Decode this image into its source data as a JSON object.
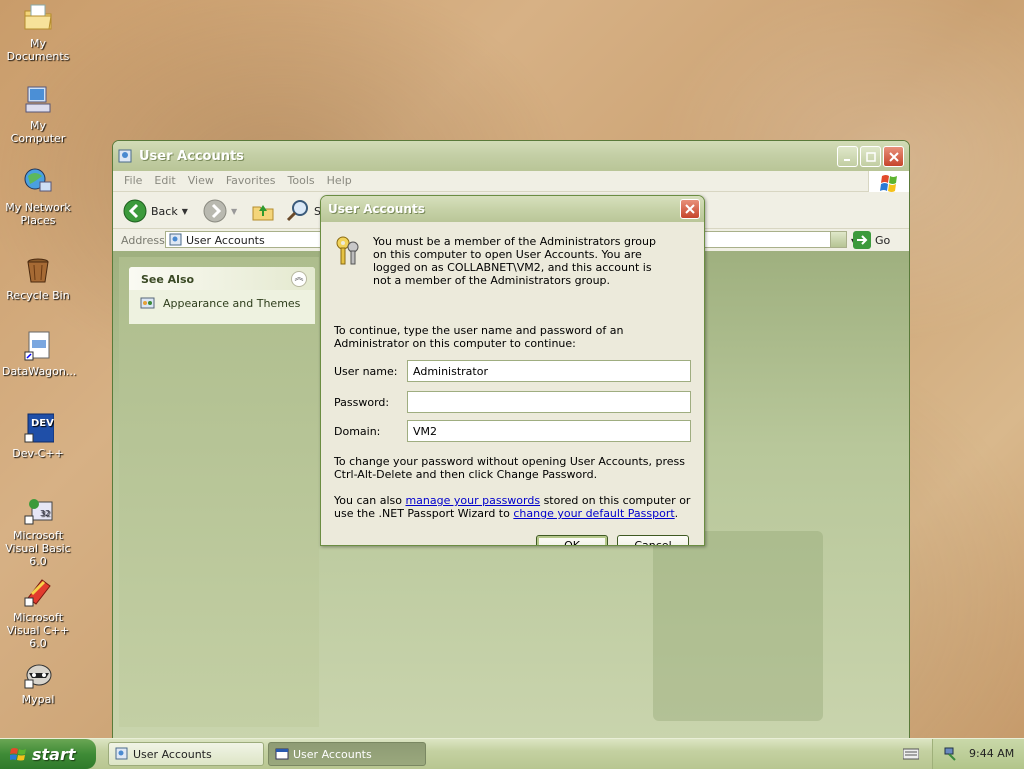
{
  "desktop": {
    "icons": [
      {
        "label": "My Documents",
        "icon": "folder-documents-icon"
      },
      {
        "label": "My Computer",
        "icon": "computer-icon"
      },
      {
        "label": "My Network Places",
        "icon": "network-places-icon"
      },
      {
        "label": "Recycle Bin",
        "icon": "recycle-bin-icon"
      },
      {
        "label": "DataWagon...",
        "icon": "datawagon-shortcut-icon"
      },
      {
        "label": "Dev-C++",
        "icon": "dev-cpp-icon"
      },
      {
        "label": "Microsoft Visual Basic 6.0",
        "icon": "visual-basic-icon"
      },
      {
        "label": "Microsoft Visual C++ 6.0",
        "icon": "visual-cpp-icon"
      },
      {
        "label": "Mypal",
        "icon": "mypal-raccoon-icon"
      }
    ]
  },
  "window": {
    "title": "User Accounts",
    "menu": [
      "File",
      "Edit",
      "View",
      "Favorites",
      "Tools",
      "Help"
    ],
    "toolbar": {
      "back_label": "Back",
      "search_label": "S"
    },
    "address": {
      "label": "Address",
      "value": "User Accounts",
      "go_label": "Go"
    },
    "see_also": {
      "heading": "See Also",
      "items": [
        "Appearance and Themes"
      ]
    }
  },
  "dialog": {
    "title": "User Accounts",
    "message": "You must be a member of the Administrators group on this computer to open User Accounts.  You are logged on as COLLABNET\\VM2, and this account is not a member of the Administrators group.",
    "instruction": "To continue, type the user name and password of an Administrator on this computer to continue:",
    "fields": {
      "username_label": "User name:",
      "username_value": "Administrator",
      "password_label": "Password:",
      "password_value": "",
      "domain_label": "Domain:",
      "domain_value": "VM2"
    },
    "change_password_text": "To change your password without opening User Accounts, press Ctrl-Alt-Delete and then click Change Password.",
    "passport_text_1": "You can also ",
    "passport_link_1": "manage your passwords",
    "passport_text_2": " stored on this computer or use the .NET Passport Wizard to ",
    "passport_link_2": "change your default Passport",
    "passport_text_3": ".",
    "ok_label": "OK",
    "cancel_label": "Cancel"
  },
  "taskbar": {
    "start_label": "start",
    "tasks": [
      "User Accounts",
      "User Accounts"
    ],
    "clock": "9:44 AM"
  }
}
